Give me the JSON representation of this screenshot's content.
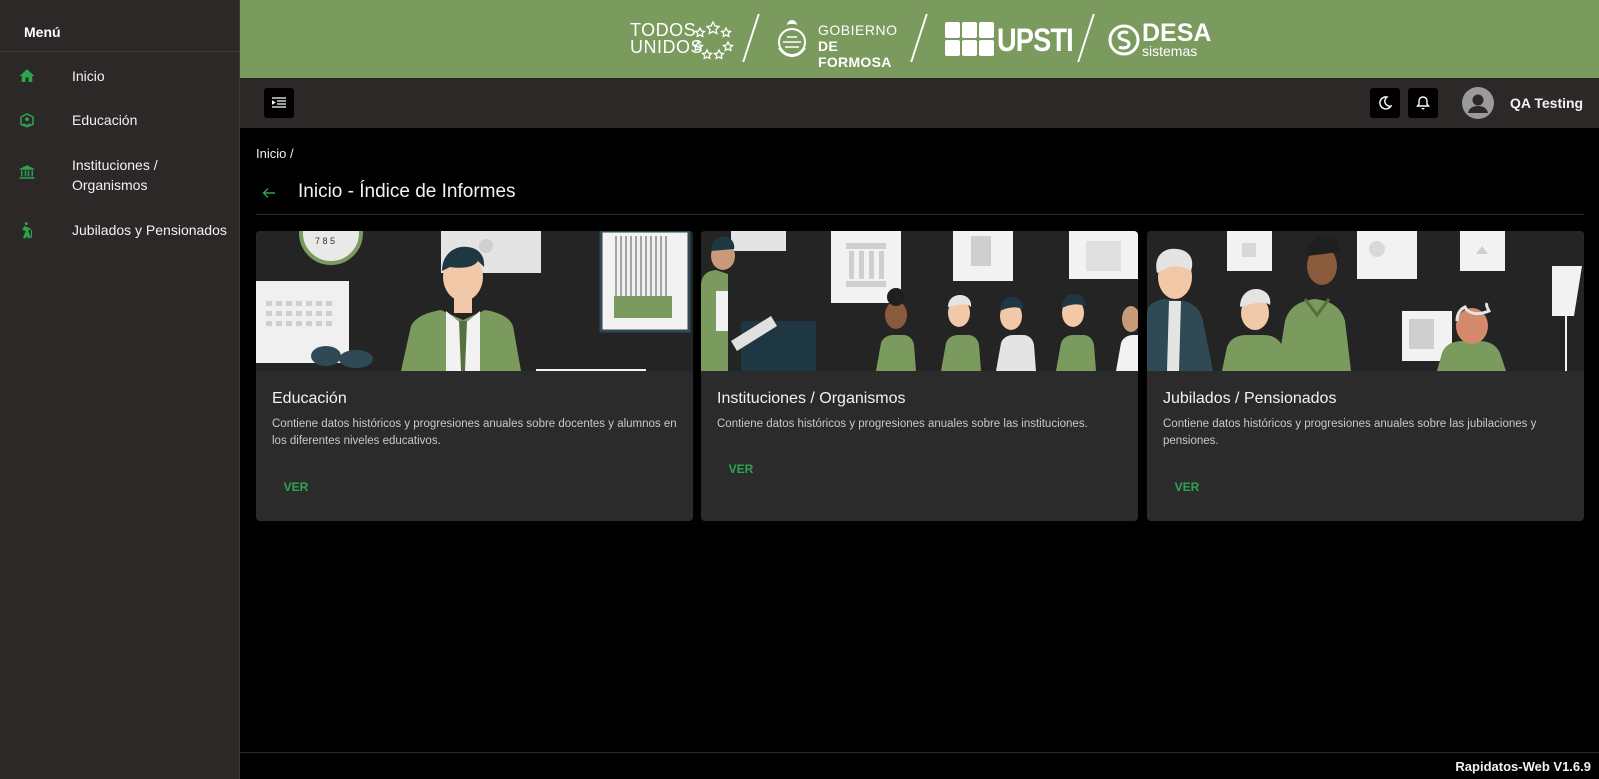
{
  "sidebar": {
    "title": "Menú",
    "items": [
      {
        "label": "Inicio",
        "icon": "home-icon"
      },
      {
        "label": "Educación",
        "icon": "education-icon"
      },
      {
        "label": "Instituciones / Organismos",
        "icon": "institution-icon"
      },
      {
        "label": "Jubilados y Pensionados",
        "icon": "elderly-walking-icon"
      }
    ]
  },
  "banner": {
    "background_color": "#7b9a5e",
    "logos": {
      "todos_line1": "TODOS",
      "todos_line2": "UNIDOS",
      "gobierno_line1": "GOBIERNO",
      "gobierno_line2": "DE FORMOSA",
      "upsti": "UPSTI",
      "desa_line1": "DESA",
      "desa_line2": "sistemas"
    }
  },
  "topbar": {
    "user_name": "QA Testing"
  },
  "breadcrumb": "Inicio /",
  "page_title": "Inicio - Índice de Informes",
  "cards": [
    {
      "title": "Educación",
      "description": "Contiene datos históricos y progresiones anuales sobre docentes y alumnos en los diferentes niveles educativos.",
      "button": "VER"
    },
    {
      "title": "Instituciones / Organismos",
      "description": "Contiene datos históricos y progresiones anuales sobre las instituciones.",
      "button": "VER"
    },
    {
      "title": "Jubilados / Pensionados",
      "description": "Contiene datos históricos y progresiones anuales sobre las jubilaciones y pensiones.",
      "button": "VER"
    }
  ],
  "footer": {
    "version": "Rapidatos-Web V1.6.9"
  },
  "colors": {
    "accent": "#2ea44f",
    "illustration_green": "#7b9a5e",
    "sidebar_bg": "#2b2827"
  }
}
